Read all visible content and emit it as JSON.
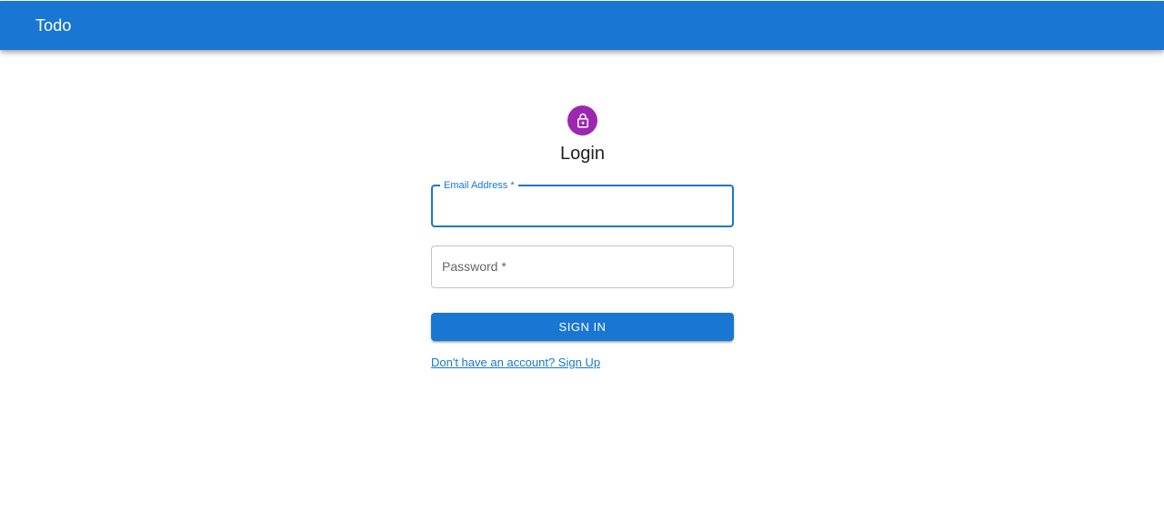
{
  "appbar": {
    "title": "Todo",
    "color": "#1976d2"
  },
  "login": {
    "avatar_icon": "lock-icon",
    "avatar_color": "#9c27b0",
    "heading": "Login",
    "email": {
      "label": "Email Address *",
      "value": ""
    },
    "password": {
      "label": "Password *",
      "value": ""
    },
    "submit_label": "SIGN IN",
    "signup_link": "Don't have an account? Sign Up"
  }
}
